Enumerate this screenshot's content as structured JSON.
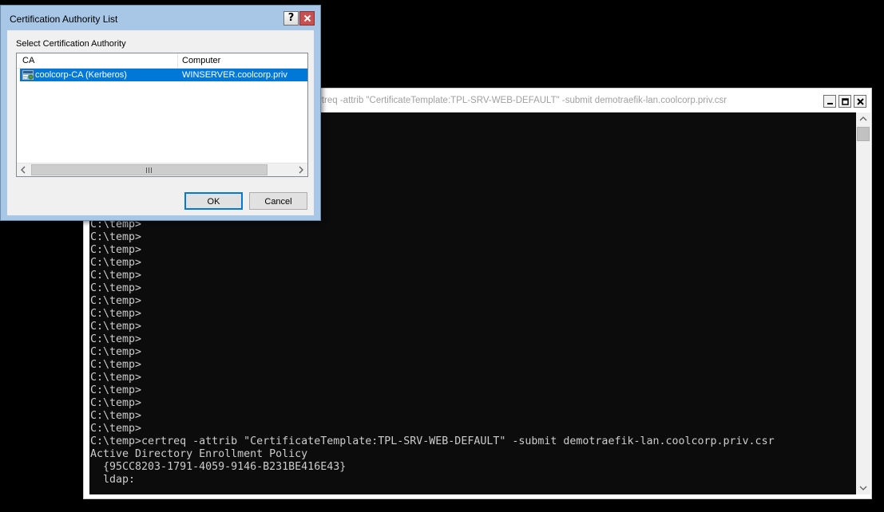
{
  "console": {
    "title": "rtreq  -attrib \"CertificateTemplate:TPL-SRV-WEB-DEFAULT\" -submit demotraefik-lan.coolcorp.priv.csr",
    "lines": [
      "C:\\temp>",
      "C:\\temp>",
      "C:\\temp>",
      "C:\\temp>",
      "C:\\temp>",
      "C:\\temp>",
      "C:\\temp>",
      "C:\\temp>",
      "C:\\temp>",
      "C:\\temp>",
      "C:\\temp>",
      "C:\\temp>",
      "C:\\temp>",
      "C:\\temp>",
      "C:\\temp>",
      "C:\\temp>",
      "C:\\temp>",
      "C:\\temp>certreq -attrib \"CertificateTemplate:TPL-SRV-WEB-DEFAULT\" -submit demotraefik-lan.coolcorp.priv.csr",
      "Active Directory Enrollment Policy",
      "  {95CC8203-1791-4059-9146-B231BE416E43}",
      "  ldap:"
    ]
  },
  "dialog": {
    "title": "Certification Authority List",
    "help_label": "?",
    "group_label": "Select Certification Authority",
    "columns": {
      "ca": "CA",
      "computer": "Computer"
    },
    "rows": [
      {
        "ca": "coolcorp-CA (Kerberos)",
        "computer": "WINSERVER.coolcorp.priv",
        "selected": true
      }
    ],
    "ok_label": "OK",
    "cancel_label": "Cancel"
  },
  "colors": {
    "selection": "#0078d7",
    "console_bg": "#0c0c0c",
    "console_fg": "#cccccc",
    "dialog_frame": "#a8c6e6",
    "close_button": "#c75050"
  }
}
